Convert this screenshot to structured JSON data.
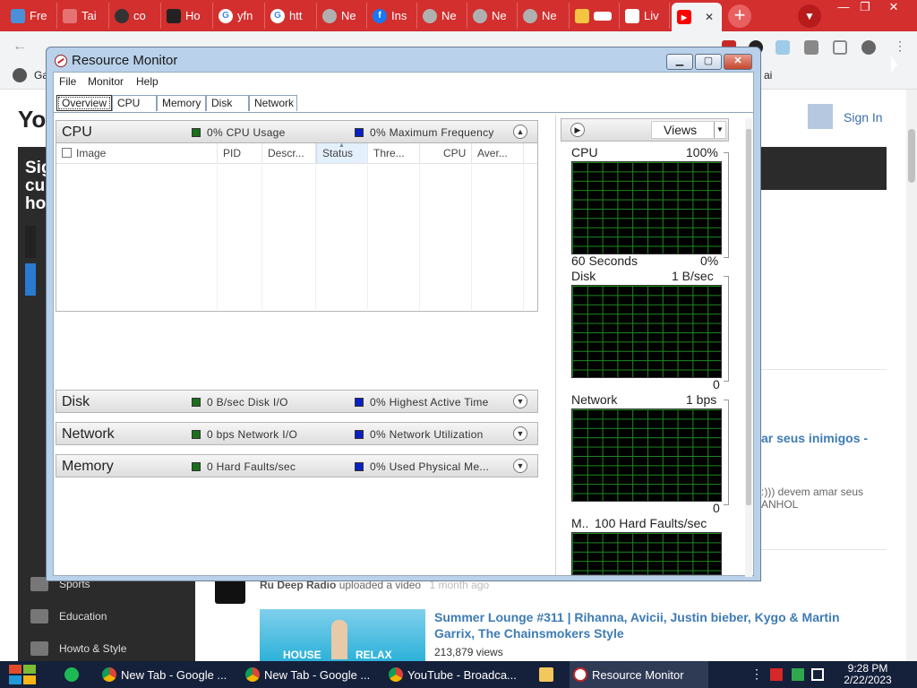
{
  "browser": {
    "tabs": [
      {
        "label": "Fre",
        "color": "#4a90d9"
      },
      {
        "label": "Tai",
        "color": "#e57373"
      },
      {
        "label": "co",
        "color": "#333333"
      },
      {
        "label": "Ho",
        "color": "#222222"
      },
      {
        "label": "yfn",
        "color": "#4285f4"
      },
      {
        "label": "htt",
        "color": "#4285f4"
      },
      {
        "label": "Ne",
        "color": "#b0b0b0"
      },
      {
        "label": "Ins",
        "color": "#1877f2"
      },
      {
        "label": "Ne",
        "color": "#b0b0b0"
      },
      {
        "label": "Ne",
        "color": "#b0b0b0"
      },
      {
        "label": "Ne",
        "color": "#b0b0b0"
      },
      {
        "label": "",
        "color": "#f5c542"
      },
      {
        "label": "Liv",
        "color": "#ffffff"
      },
      {
        "label": "",
        "color": "#ff0000",
        "active": true
      }
    ],
    "active_close": "✕",
    "new_tab": "+",
    "bookmark_partial": "Ga",
    "bookmark_right": "ai",
    "tabbar_color": "#d32f2f"
  },
  "youtube": {
    "logo": "You",
    "sign_in": "Sign In",
    "sidebar_promo": [
      "Sig",
      "cu",
      "ho"
    ],
    "sidebar_items": [
      {
        "label": "Sports",
        "icon": "sports-icon"
      },
      {
        "label": "Education",
        "icon": "education-icon"
      },
      {
        "label": "Howto & Style",
        "icon": "howto-icon"
      }
    ],
    "partial_title": "ar seus inimigos -",
    "partial_meta_1": ":))) devem amar seus",
    "partial_meta_2": "ANHOL",
    "feed_channel": "Ru Deep Radio",
    "feed_action": "uploaded a video",
    "feed_time": "1 month ago",
    "video_title": "Summer Lounge #311 | Rihanna, Avicii, Justin bieber, Kygo & Martin Garrix, The Chainsmokers Style",
    "video_views": "213,879 views",
    "thumb_text_left": "HOUSE",
    "thumb_text_right": "RELAX"
  },
  "resmon": {
    "title": "Resource Monitor",
    "minimize": "▁",
    "maximize": "▢",
    "close": "✕",
    "menu": [
      "File",
      "Monitor",
      "Help"
    ],
    "tabs": [
      "Overview",
      "CPU",
      "Memory",
      "Disk",
      "Network"
    ],
    "active_tab": "Overview",
    "cpu": {
      "title": "CPU",
      "stat1": "0% CPU Usage",
      "stat2": "0% Maximum Frequency",
      "columns": [
        "Image",
        "PID",
        "Descr...",
        "Status",
        "Thre...",
        "CPU",
        "Aver..."
      ],
      "sorted_column": "Status",
      "expanded": true
    },
    "disk": {
      "title": "Disk",
      "stat1": "0 B/sec Disk I/O",
      "stat2": "0% Highest Active Time"
    },
    "network": {
      "title": "Network",
      "stat1": "0 bps Network I/O",
      "stat2": "0% Network Utilization"
    },
    "memory": {
      "title": "Memory",
      "stat1": "0 Hard Faults/sec",
      "stat2": "0% Used Physical Me..."
    },
    "views_label": "Views",
    "graphs": [
      {
        "name": "CPU",
        "max": "100%",
        "footer_left": "60 Seconds",
        "footer_right": "0%"
      },
      {
        "name": "Disk",
        "max": "1 B/sec",
        "footer_right": "0"
      },
      {
        "name": "Network",
        "max": "1 bps",
        "footer_right": "0"
      },
      {
        "name": "M..",
        "max": "100 Hard Faults/sec"
      }
    ]
  },
  "taskbar": {
    "items": [
      {
        "label": "New Tab - Google ...",
        "icon": "chrome-icon"
      },
      {
        "label": "New Tab - Google ...",
        "icon": "chrome-icon"
      },
      {
        "label": "YouTube - Broadca...",
        "icon": "chrome-icon"
      },
      {
        "label": "",
        "icon": "folder-icon"
      },
      {
        "label": "Resource Monitor",
        "icon": "resmon-icon",
        "active": true
      }
    ],
    "time": "9:28 PM",
    "date": "2/22/2023"
  }
}
